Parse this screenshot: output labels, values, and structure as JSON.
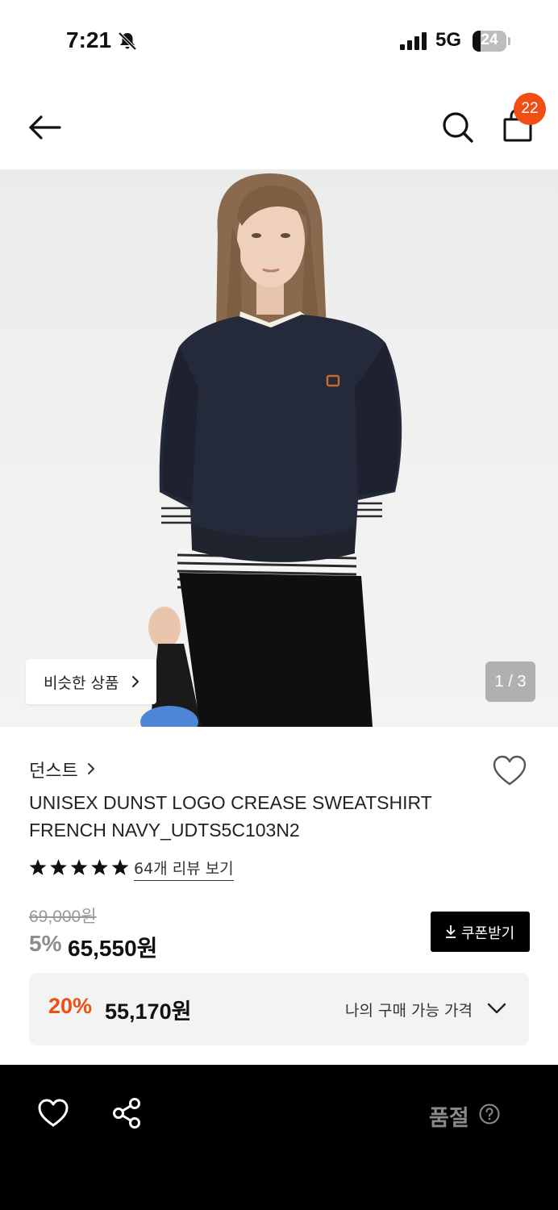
{
  "status_bar": {
    "time": "7:21",
    "network": "5G",
    "battery": "24"
  },
  "header": {
    "cart_count": "22"
  },
  "gallery": {
    "similar_label": "비슷한 상품",
    "pager": "1 / 3"
  },
  "product": {
    "brand": "던스트",
    "title": "UNISEX DUNST LOGO CREASE SWEATSHIRT FRENCH NAVY_UDTS5C103N2",
    "rating_stars": 5,
    "reviews_label": "64개 리뷰 보기",
    "original_price": "69,000원",
    "discount_rate": "5%",
    "sale_price": "65,550",
    "sale_price_unit": "원",
    "coupon_label": "쿠폰받기",
    "my_price": {
      "rate": "20%",
      "amount": "55,170원",
      "label": "나의 구매 가능 가격"
    }
  },
  "bottom_bar": {
    "status_label": "품절"
  },
  "colors": {
    "accent": "#f04e12",
    "bottom_bar": "#000000",
    "price_box": "#f3f3f3"
  }
}
